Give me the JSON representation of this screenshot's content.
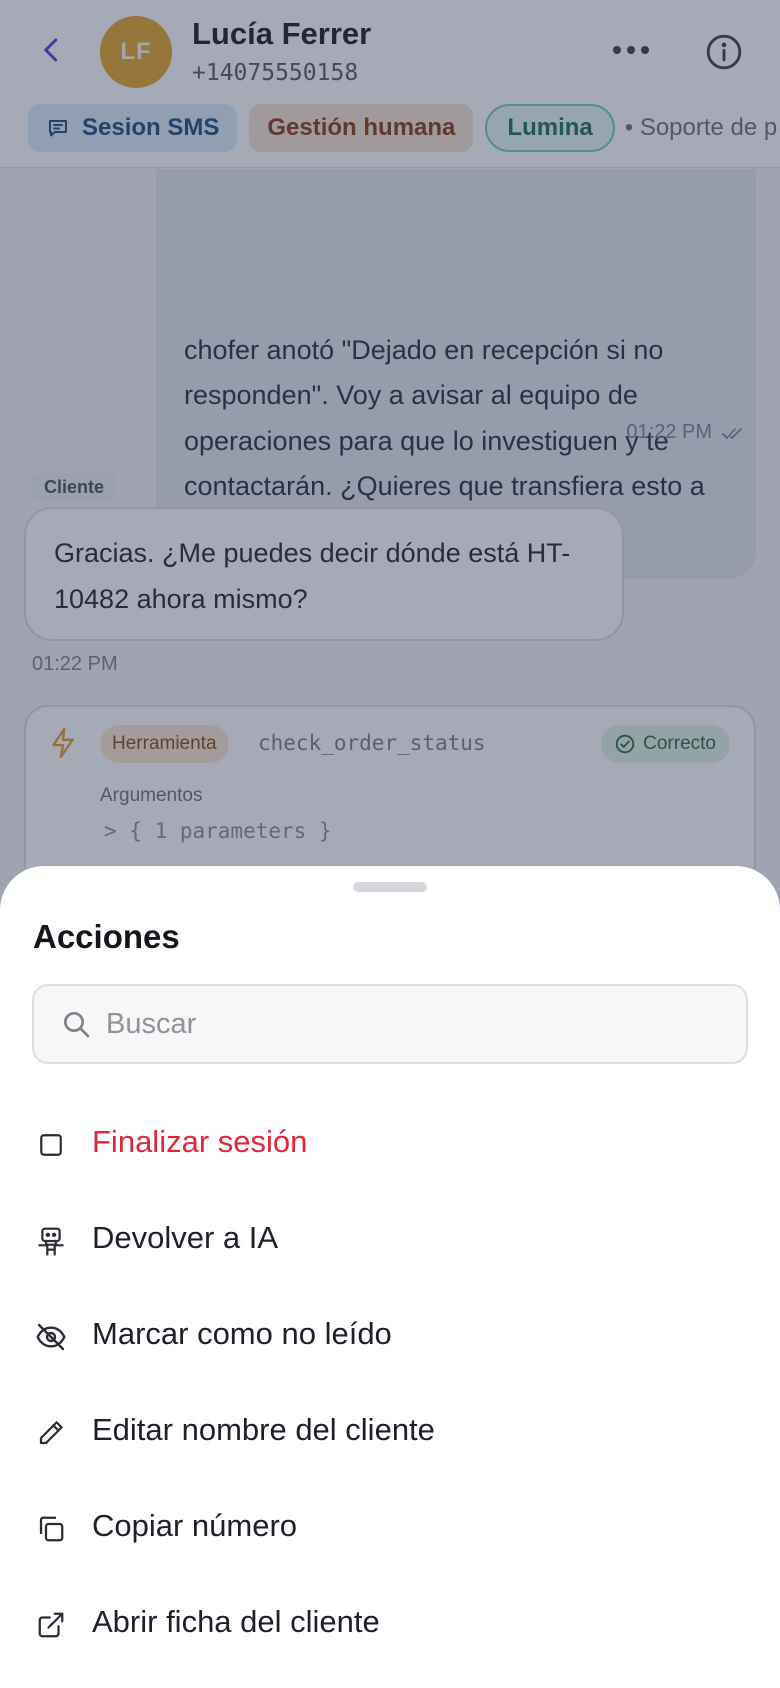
{
  "header": {
    "avatar_initials": "LF",
    "avatar_color": "#e3a52a",
    "name": "Lucía Ferrer",
    "phone": "+14075550158",
    "chips": {
      "session": "Sesion SMS",
      "handling": "Gestión humana",
      "assistant": "Lumina",
      "support": "• Soporte de p"
    },
    "accent_color": "#5b3fd6"
  },
  "chat": {
    "agent_message": "chofer anotó \"Dejado en recepción si no responden\". Voy a avisar al equipo de operaciones para que lo investiguen y te contactarán. ¿Quieres que transfiera esto a un agente humano?",
    "agent_time": "01:22 PM",
    "client_label": "Cliente",
    "client_message": "Gracias. ¿Me puedes decir dónde está HT-10482 ahora mismo?",
    "client_time": "01:22 PM",
    "tool": {
      "tag": "Herramienta",
      "name": "check_order_status",
      "status": "Correcto",
      "args_label": "Argumentos",
      "args_value": "> { 1 parameters }"
    }
  },
  "sheet": {
    "title": "Acciones",
    "search_placeholder": "Buscar",
    "actions": [
      {
        "label": "Finalizar sesión",
        "icon": "square-icon",
        "danger": true
      },
      {
        "label": "Devolver a IA",
        "icon": "robot-icon"
      },
      {
        "label": "Marcar como no leído",
        "icon": "eye-off-icon"
      },
      {
        "label": "Editar nombre del cliente",
        "icon": "pencil-icon"
      },
      {
        "label": "Copiar número",
        "icon": "copy-icon"
      },
      {
        "label": "Abrir ficha del cliente",
        "icon": "external-link-icon"
      }
    ],
    "danger_color": "#e0263a"
  }
}
